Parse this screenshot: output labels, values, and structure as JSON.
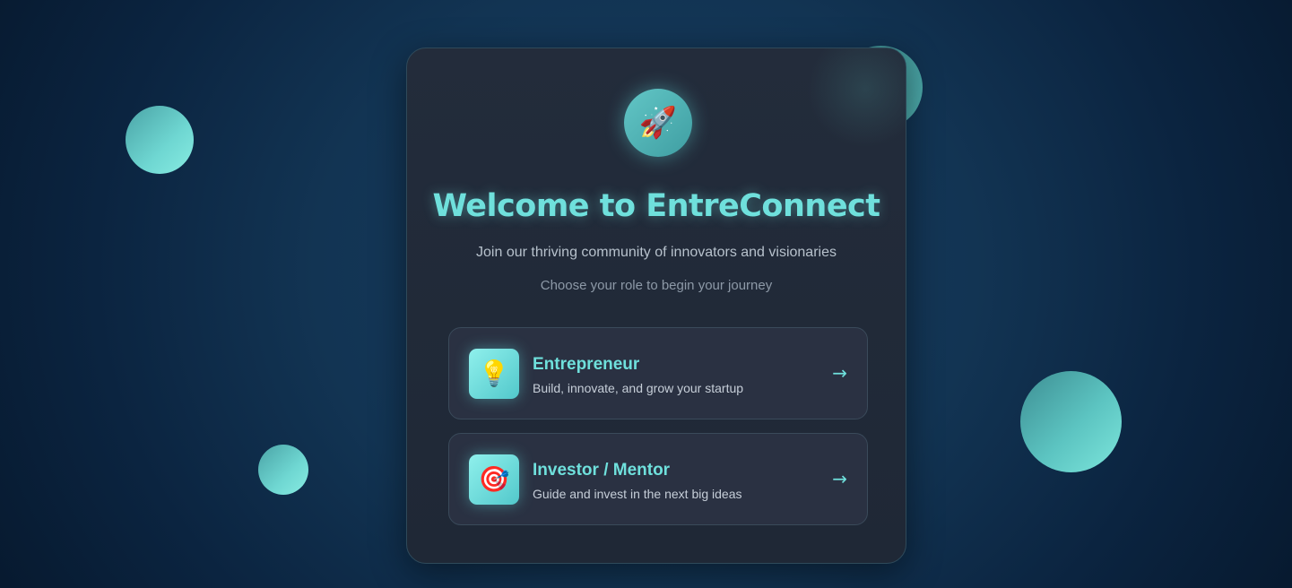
{
  "app": {
    "logo_icon": "🚀",
    "logo_icon_name": "rocket-icon",
    "title": "Welcome to EntreConnect",
    "subtitle": "Join our thriving community of innovators and visionaries",
    "hint": "Choose your role to begin your journey"
  },
  "roles": [
    {
      "icon": "💡",
      "icon_name": "lightbulb-icon",
      "title": "Entrepreneur",
      "description": "Build, innovate, and grow your startup",
      "arrow": "→"
    },
    {
      "icon": "🎯",
      "icon_name": "target-icon",
      "title": "Investor / Mentor",
      "description": "Guide and invest in the next big ideas",
      "arrow": "→"
    }
  ],
  "colors": {
    "accent": "#6fe0dc",
    "card_background": "#232c3b",
    "page_background": "#123453",
    "bubble": "#6fd7d2"
  }
}
